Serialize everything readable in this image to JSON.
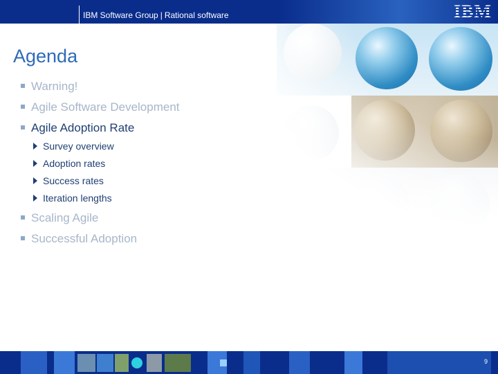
{
  "header": {
    "group_label": "IBM Software Group",
    "separator": "|",
    "unit_label": "Rational software",
    "logo_text": "IBM"
  },
  "title": "Agenda",
  "agenda_items": [
    {
      "label": "Warning!",
      "state": "dim"
    },
    {
      "label": "Agile Software Development",
      "state": "dim"
    },
    {
      "label": "Agile Adoption Rate",
      "state": "active",
      "subitems": [
        "Survey overview",
        "Adoption rates",
        "Success rates",
        "Iteration lengths"
      ]
    },
    {
      "label": "Scaling Agile",
      "state": "dim"
    },
    {
      "label": "Successful Adoption",
      "state": "dim"
    }
  ],
  "footer": {
    "page_number": "9"
  },
  "colors": {
    "brand_blue": "#0a2d8c",
    "title_blue": "#2e6ab8",
    "active_text": "#1f3f73",
    "dim_text": "#a7b6c9"
  }
}
